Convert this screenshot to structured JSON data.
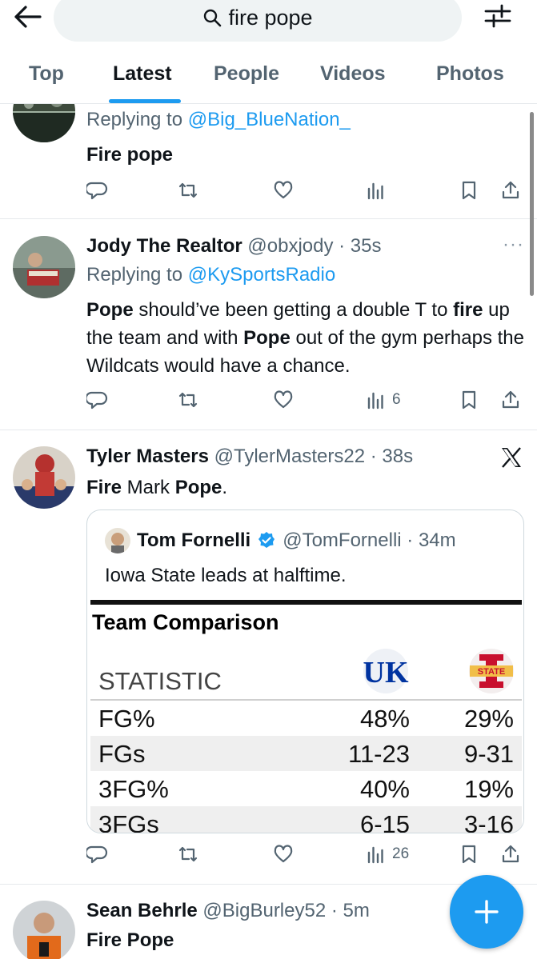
{
  "search": {
    "query": "fire pope"
  },
  "tabs": [
    {
      "label": "Top"
    },
    {
      "label": "Latest",
      "active": true
    },
    {
      "label": "People"
    },
    {
      "label": "Videos"
    },
    {
      "label": "Photos"
    }
  ],
  "colors": {
    "accent": "#1d9bf0",
    "text": "#0f1419",
    "muted": "#536471"
  },
  "tweets": [
    {
      "reply_prefix": "Replying to ",
      "reply_to": "@Big_BlueNation_",
      "body": "Fire pope",
      "views": ""
    },
    {
      "name": "Jody The Realtor",
      "handle": "@obxjody · 35s",
      "reply_prefix": "Replying to ",
      "reply_to": "@KySportsRadio",
      "body_parts": [
        "Pope",
        " should’ve been getting a double T to ",
        "fire",
        " up the team and with ",
        "Pope",
        " out of the gym perhaps the Wildcats would have a chance."
      ],
      "more": "···",
      "views": "6"
    },
    {
      "name": "Tyler Masters",
      "handle": "@TylerMasters22 · 38s",
      "body_parts": [
        "Fire",
        " Mark ",
        "Pope",
        "."
      ],
      "views": "26",
      "quote": {
        "name": "Tom Fornelli",
        "handle": "@TomFornelli · 34m",
        "text": "Iowa State leads at halftime.",
        "image": {
          "title": "Team Comparison",
          "col_header": "STATISTIC",
          "team1_logo": "UK",
          "team2_logo": "STATE",
          "rows": [
            {
              "stat": "FG%",
              "t1": "48%",
              "t2": "29%"
            },
            {
              "stat": "FGs",
              "t1": "11-23",
              "t2": "9-31"
            },
            {
              "stat": "3FG%",
              "t1": "40%",
              "t2": "19%"
            },
            {
              "stat": "3FGs",
              "t1": "6-15",
              "t2": "3-16"
            }
          ]
        }
      }
    },
    {
      "name": "Sean Behrle",
      "handle": "@BigBurley52 · 5m",
      "body": "Fire Pope"
    }
  ],
  "icons": [
    "back-arrow-icon",
    "search-icon",
    "filter-icon",
    "reply-icon",
    "retweet-icon",
    "like-icon",
    "views-icon",
    "bookmark-icon",
    "share-icon",
    "x-logo-icon",
    "verified-icon",
    "compose-plus-icon"
  ]
}
